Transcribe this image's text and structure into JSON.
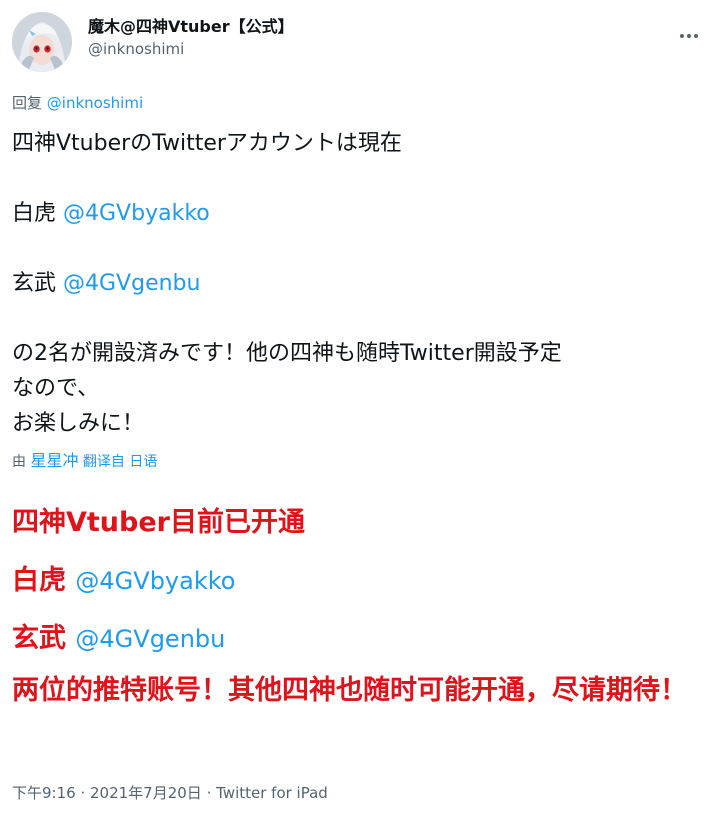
{
  "author": {
    "display_name": "魔木@四神Vtuber【公式】",
    "handle": "@inknoshimi"
  },
  "reply": {
    "prefix": "回复",
    "handle": "@inknoshimi"
  },
  "tweet": {
    "line1": "四神VtuberのTwitterアカウントは現在",
    "byakko_prefix": "白虎",
    "byakko_handle": "@4GVbyakko",
    "genbu_prefix": "玄武",
    "genbu_handle": "@4GVgenbu",
    "line_closing_1": "の2名が開設済みです！他の四神も随時Twitter開設予定",
    "line_closing_2": "なので、",
    "line_closing_3": "お楽しみに！"
  },
  "translation_credit": {
    "by": "由",
    "translator": "星星冲",
    "translated_from": "翻译自",
    "language": "日语"
  },
  "translated": {
    "line1": "四神Vtuber目前已开通",
    "byakko_prefix": "白虎",
    "byakko_handle": "@4GVbyakko",
    "genbu_prefix": "玄武",
    "genbu_handle": "@4GVgenbu",
    "line4": "两位的推特账号！其他四神也随时可能开通，尽请期待！"
  },
  "meta": {
    "time": "下午9:16",
    "separator1": " · ",
    "date": "2021年7月20日",
    "separator2": " · ",
    "source": "Twitter for iPad"
  },
  "colors": {
    "link": "#1d9bf0",
    "secondary_text": "#536471",
    "primary_text": "#0f1419",
    "translation_red": "#e0131b"
  },
  "icons": {
    "more": "more-horizontal-icon"
  }
}
